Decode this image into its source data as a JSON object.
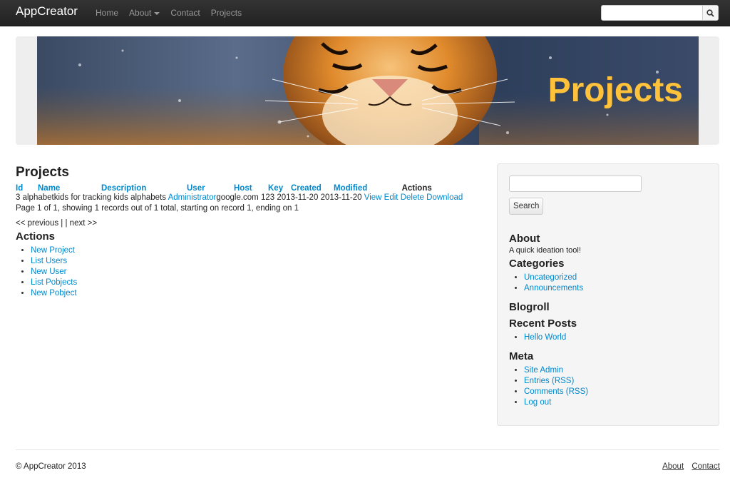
{
  "navbar": {
    "brand": "AppCreator",
    "links": [
      "Home",
      "About",
      "Contact",
      "Projects"
    ],
    "search_placeholder": ""
  },
  "hero": {
    "title": "Projects"
  },
  "main": {
    "title": "Projects",
    "columns": [
      "Id",
      "Name",
      "Description",
      "User",
      "Host",
      "Key",
      "Created",
      "Modified",
      "Actions"
    ],
    "rows": [
      {
        "id": "3",
        "name": "alphabetkids",
        "description": "for tracking kids alphabets",
        "user": "Administrator",
        "host": "google.com",
        "key": "123",
        "created": "2013-11-20",
        "modified": "2013-11-20",
        "actions": [
          "View",
          "Edit",
          "Delete",
          "Download"
        ]
      }
    ],
    "page_info": "Page 1 of 1, showing 1 records out of 1 total, starting on record 1, ending on 1",
    "pager": {
      "previous": "<< previous",
      "separator": " | | ",
      "next": "next >>"
    },
    "actions_title": "Actions",
    "actions": [
      "New Project",
      "List Users",
      "New User",
      "List Pobjects",
      "New Pobject"
    ]
  },
  "sidebar": {
    "search_button": "Search",
    "about_title": "About",
    "about_text": "A quick ideation tool!",
    "categories_title": "Categories",
    "categories": [
      "Uncategorized",
      "Announcements"
    ],
    "blogroll_title": "Blogroll",
    "recent_title": "Recent Posts",
    "recent": [
      "Hello World"
    ],
    "meta_title": "Meta",
    "meta": [
      "Site Admin",
      "Entries (RSS)",
      "Comments (RSS)",
      "Log out"
    ]
  },
  "footer": {
    "copyright": "© AppCreator 2013",
    "links": [
      "About",
      "Contact"
    ]
  },
  "colors": {
    "link": "#0088cc",
    "navbar": "#222222",
    "hero_title": "#ffc23a"
  }
}
